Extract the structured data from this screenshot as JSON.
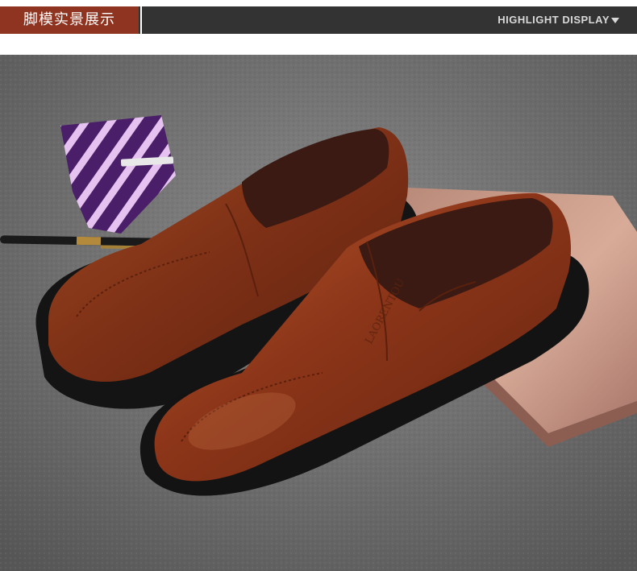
{
  "header": {
    "title": "脚模实景展示",
    "subtitle": "HIGHLIGHT DISPLAY",
    "arrow_icon": "triangle-down-icon"
  },
  "product_photo": {
    "brand_emboss": "LAORENTOU",
    "colors": {
      "banner_accent": "#8f3420",
      "banner_dark": "#333333",
      "leather": "#8a3a1c",
      "sole": "#1c1a1a",
      "carpet": "#6f6f6f",
      "tie_purple": "#7b2a8f",
      "laptop": "#c99a88"
    }
  }
}
